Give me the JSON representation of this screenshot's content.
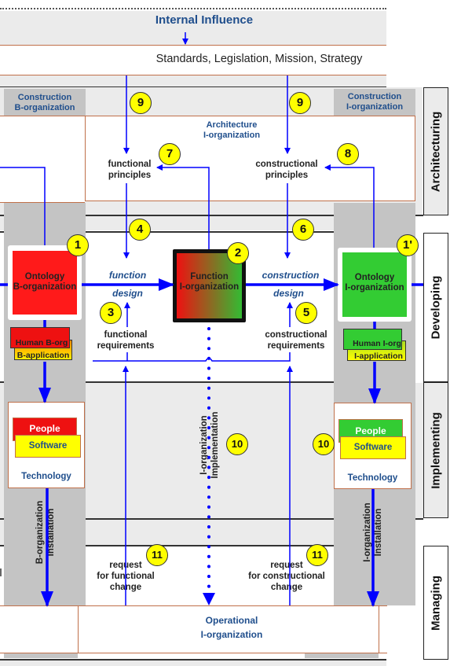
{
  "header": {
    "title": "Internal Influence",
    "subtitle": "Standards, Legislation, Mission, Strategy"
  },
  "columns": {
    "left_header": [
      "Construction",
      "B-organization"
    ],
    "right_header": [
      "Construction",
      "I-organization"
    ]
  },
  "architecture": {
    "title": [
      "Architecture",
      "I-organization"
    ],
    "functional_principles": [
      "functional",
      "principles"
    ],
    "constructional_principles": [
      "constructional",
      "principles"
    ]
  },
  "developing": {
    "ontology_b": [
      "Ontology",
      "B-organization"
    ],
    "function_i": [
      "Function",
      "I-organization"
    ],
    "ontology_i": [
      "Ontology",
      "I-organization"
    ],
    "function_design": [
      "function",
      "design"
    ],
    "construction_design": [
      "construction",
      "design"
    ],
    "functional_requirements": [
      "functional",
      "requirements"
    ],
    "constructional_requirements": [
      "constructional",
      "requirements"
    ],
    "human_b_org": "Human B-org",
    "b_application": "B-application",
    "human_i_org": "Human I-org",
    "i_application": "I-application"
  },
  "implementing": {
    "left_people": "People",
    "left_software": "Software",
    "left_technology": "Technology",
    "right_people": "People",
    "right_software": "Software",
    "right_technology": "Technology",
    "i_org_implementation": [
      "I-organization",
      "Implementation"
    ]
  },
  "installation": {
    "left": [
      "B-organization",
      "Installation"
    ],
    "right": [
      "I-organization",
      "Installation"
    ]
  },
  "managing": {
    "request_functional": [
      "request",
      "for functional",
      "change"
    ],
    "request_constructional": [
      "request",
      "for constructional",
      "change"
    ],
    "operational": [
      "Operational",
      "I-organization"
    ]
  },
  "phases": [
    "Architecturing",
    "Developing",
    "Implementing",
    "Managing"
  ],
  "badges": {
    "b1": "1",
    "b1p": "1'",
    "b2": "2",
    "b3": "3",
    "b4": "4",
    "b5": "5",
    "b6": "6",
    "b7": "7",
    "b8": "8",
    "b9a": "9",
    "b9b": "9",
    "b10a": "10",
    "b10b": "10",
    "b11a": "11",
    "b11b": "11"
  },
  "colors": {
    "arrow_blue": "#0000ff",
    "b_org_red": "#ff1a1a",
    "i_org_green": "#33cc33",
    "badge_yellow": "#ffff00",
    "label_navy": "#1f4e8c",
    "border_brown": "#c0704a"
  }
}
